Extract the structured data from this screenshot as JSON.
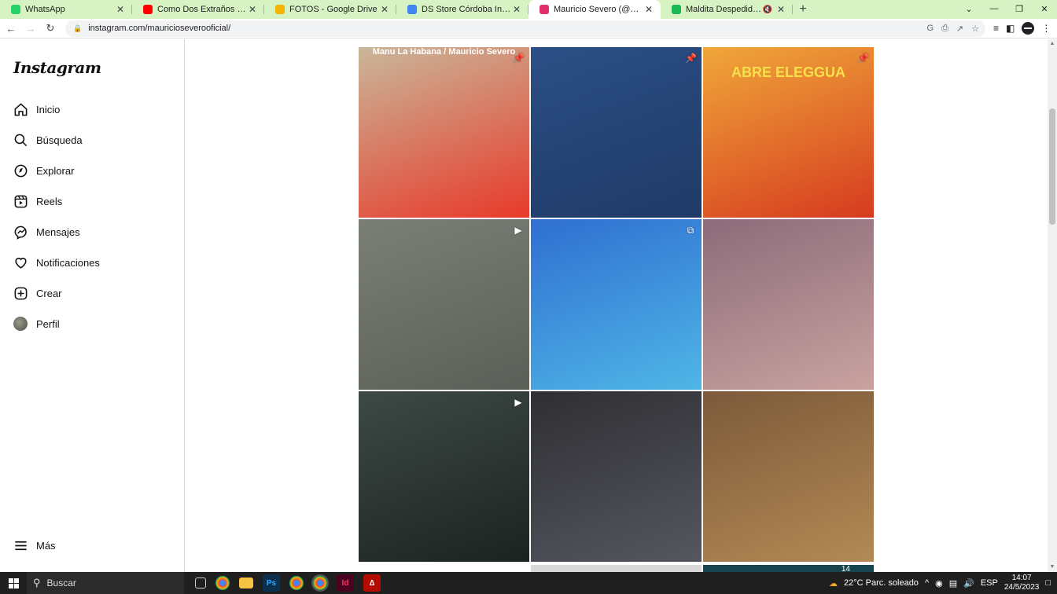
{
  "browser": {
    "tabs": [
      {
        "title": "WhatsApp",
        "icon": "whatsapp-icon",
        "color": "#25d366",
        "active": false
      },
      {
        "title": "Como Dos Extraños con Martin D",
        "icon": "youtube-icon",
        "color": "#ff0000",
        "active": false
      },
      {
        "title": "FOTOS - Google Drive",
        "icon": "google-drive-icon",
        "color": "#f4b400",
        "active": false
      },
      {
        "title": "DS Store Córdoba Invita a Un Vi",
        "icon": "google-docs-icon",
        "color": "#4285f4",
        "active": false
      },
      {
        "title": "Mauricio Severo (@mauricioseve",
        "icon": "instagram-icon",
        "color": "#e1306c",
        "active": true
      },
      {
        "title": "Maldita Despedida • Reik",
        "icon": "spotify-icon",
        "color": "#1db954",
        "active": false
      }
    ],
    "url": "instagram.com/mauricioseverooficial/"
  },
  "instagram": {
    "logo": "Instagram",
    "nav": [
      {
        "label": "Inicio",
        "icon": "home-icon"
      },
      {
        "label": "Búsqueda",
        "icon": "search-icon"
      },
      {
        "label": "Explorar",
        "icon": "compass-icon"
      },
      {
        "label": "Reels",
        "icon": "reels-icon"
      },
      {
        "label": "Mensajes",
        "icon": "messenger-icon"
      },
      {
        "label": "Notificaciones",
        "icon": "heart-icon"
      },
      {
        "label": "Crear",
        "icon": "plus-square-icon"
      },
      {
        "label": "Perfil",
        "icon": "avatar"
      }
    ],
    "more": "Más",
    "posts": [
      {
        "caption": "Manu La Habana / Mauricio Severo",
        "badge": "pin-icon",
        "colors": [
          "#c9b79a",
          "#e83a2a"
        ]
      },
      {
        "caption": "",
        "badge": "pin-icon",
        "colors": [
          "#2b4f86",
          "#1f3a66"
        ]
      },
      {
        "caption": "ABRE ELEGGUA",
        "badge": "pin-icon",
        "colors": [
          "#f0a73a",
          "#d63b1f"
        ]
      },
      {
        "caption": "",
        "badge": "reel-icon",
        "colors": [
          "#7a7f76",
          "#5a5f58"
        ]
      },
      {
        "caption": "",
        "badge": "carousel-icon",
        "colors": [
          "#2f6fd1",
          "#4fb6e6"
        ]
      },
      {
        "caption": "",
        "badge": "",
        "colors": [
          "#8c6b7a",
          "#c9a3a0"
        ]
      },
      {
        "caption": "",
        "badge": "reel-icon",
        "colors": [
          "#3d4a45",
          "#1c2220"
        ]
      },
      {
        "caption": "",
        "badge": "",
        "colors": [
          "#2f2f33",
          "#555760"
        ]
      },
      {
        "caption": "",
        "badge": "",
        "colors": [
          "#7c5a3a",
          "#b38a55"
        ]
      }
    ],
    "partial_row_colors": [
      "#ffffff",
      "#d9d9d9",
      "#17444f"
    ],
    "partial_caption": "14"
  },
  "taskbar": {
    "search_label": "Buscar",
    "weather": "22°C  Parc. soleado",
    "language": "ESP",
    "time": "14:07",
    "date": "24/5/2023"
  }
}
